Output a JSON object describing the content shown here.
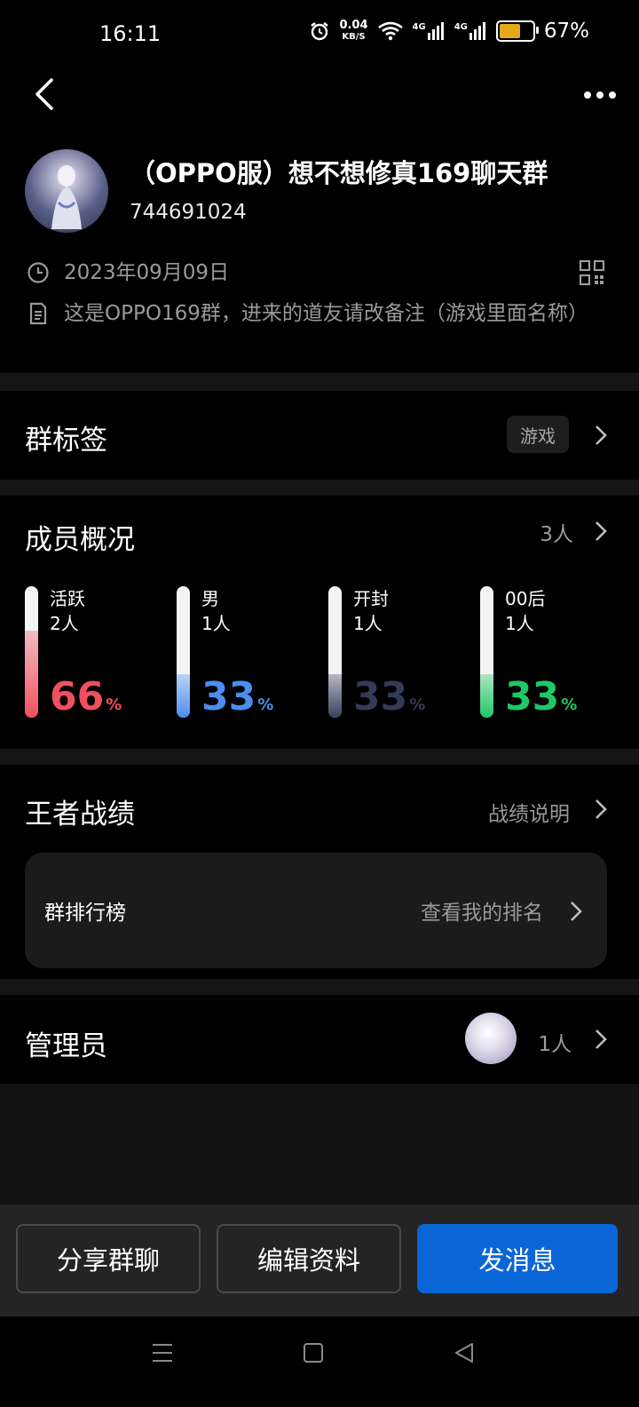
{
  "status_bar": {
    "time": "16:11",
    "net_speed_value": "0.04",
    "net_speed_unit": "KB/S",
    "signal_1": "4G",
    "signal_2": "4G",
    "battery_percent": "67%",
    "battery_level": 0.67,
    "icons": [
      "alarm-icon",
      "wifi-icon",
      "signal-icon",
      "battery-icon"
    ]
  },
  "header": {
    "group_name": "（OPPO服）想不想修真169聊天群",
    "group_id": "744691024",
    "created_date": "2023年09月09日",
    "description": "这是OPPO169群，进来的道友请改备注（游戏里面名称）"
  },
  "group_tags": {
    "title": "群标签",
    "tag": "游戏"
  },
  "members": {
    "title": "成员概况",
    "count": "3人",
    "stats": [
      {
        "label": "活跃",
        "count": "2人",
        "percent": "66",
        "percent_sign": "%",
        "fill": 0.66,
        "color": "#f0505e"
      },
      {
        "label": "男",
        "count": "1人",
        "percent": "33",
        "percent_sign": "%",
        "fill": 0.33,
        "color": "#4b8ef0"
      },
      {
        "label": "开封",
        "count": "1人",
        "percent": "33",
        "percent_sign": "%",
        "fill": 0.33,
        "color": "#3a3f5c"
      },
      {
        "label": "00后",
        "count": "1人",
        "percent": "33",
        "percent_sign": "%",
        "fill": 0.33,
        "color": "#1ec864"
      }
    ]
  },
  "records": {
    "title": "王者战绩",
    "link": "战绩说明",
    "rank_title": "群排行榜",
    "rank_link": "查看我的排名"
  },
  "admins": {
    "title": "管理员",
    "count": "1人"
  },
  "actions": {
    "share": "分享群聊",
    "edit": "编辑资料",
    "send": "发消息"
  },
  "colors": {
    "accent": "#0a66d6",
    "background": "#000000"
  }
}
